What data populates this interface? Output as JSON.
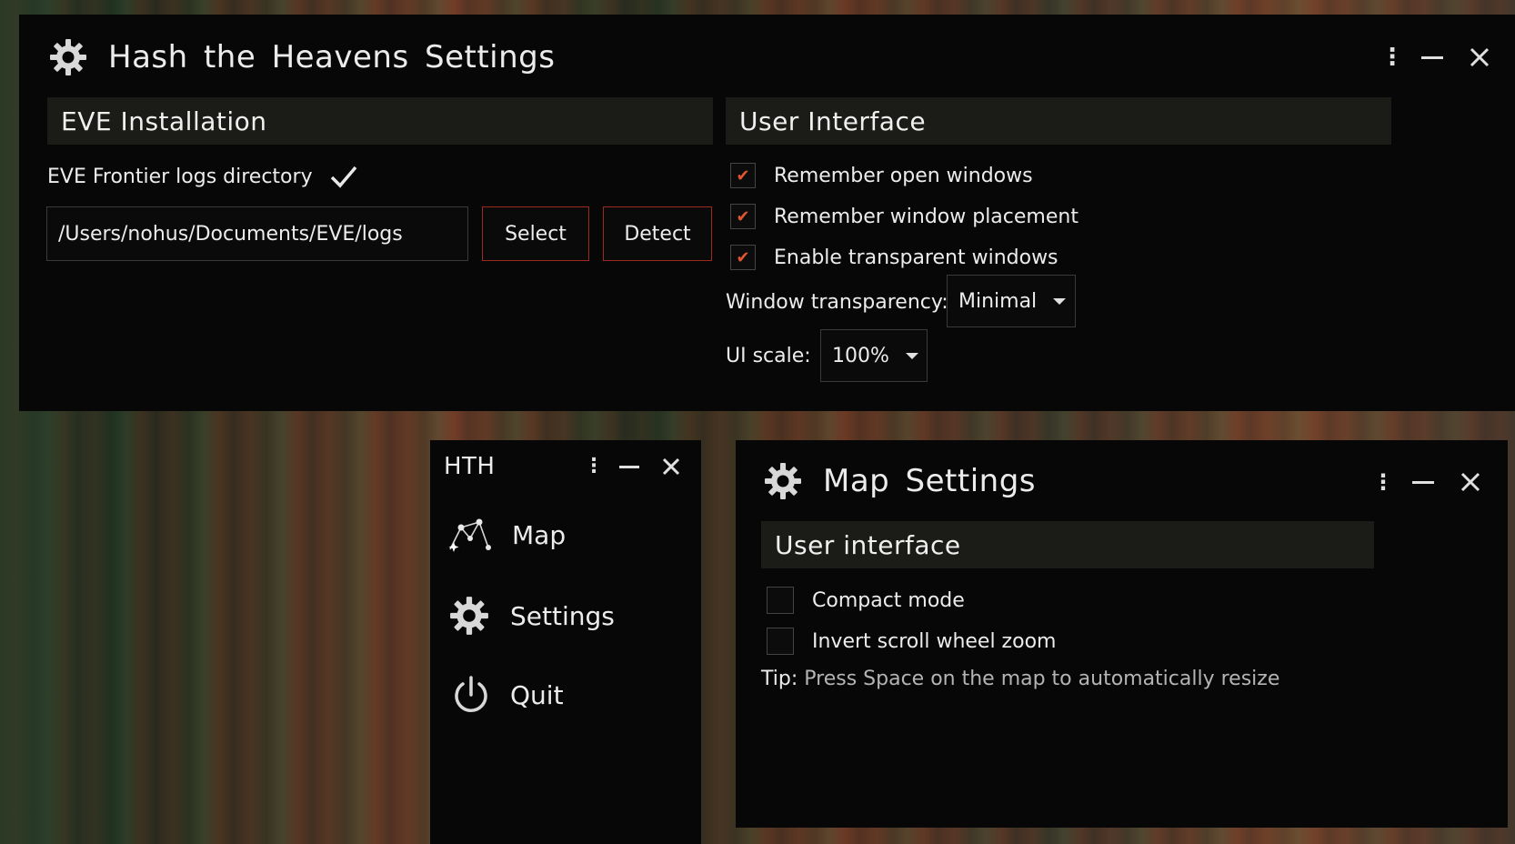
{
  "settings_window": {
    "title": "Hash the Heavens Settings",
    "eve_section": {
      "heading": "EVE Installation",
      "logs_label": "EVE Frontier logs directory",
      "logs_path": "/Users/nohus/Documents/EVE/logs",
      "select_label": "Select",
      "detect_label": "Detect"
    },
    "ui_section": {
      "heading": "User Interface",
      "checkboxes": [
        {
          "label": "Remember open windows",
          "checked": true
        },
        {
          "label": "Remember window placement",
          "checked": true
        },
        {
          "label": "Enable transparent windows",
          "checked": true
        }
      ],
      "transparency_label": "Window transparency:",
      "transparency_value": "Minimal",
      "scale_label": "UI scale:",
      "scale_value": "100%"
    }
  },
  "hth_window": {
    "title": "HTH",
    "items": [
      {
        "label": "Map",
        "icon": "map-icon"
      },
      {
        "label": "Settings",
        "icon": "gear-icon"
      },
      {
        "label": "Quit",
        "icon": "power-icon"
      }
    ]
  },
  "map_settings_window": {
    "title": "Map Settings",
    "heading": "User interface",
    "checkboxes": [
      {
        "label": "Compact mode",
        "checked": false
      },
      {
        "label": "Invert scroll wheel zoom",
        "checked": false
      }
    ],
    "tip_prefix": "Tip:",
    "tip_text": "Press Space on the map to automatically resize"
  },
  "colors": {
    "accent": "#e2562f",
    "button_border": "#9c2a1e",
    "window_bg": "#070707",
    "section_bg": "#1b1b17"
  }
}
